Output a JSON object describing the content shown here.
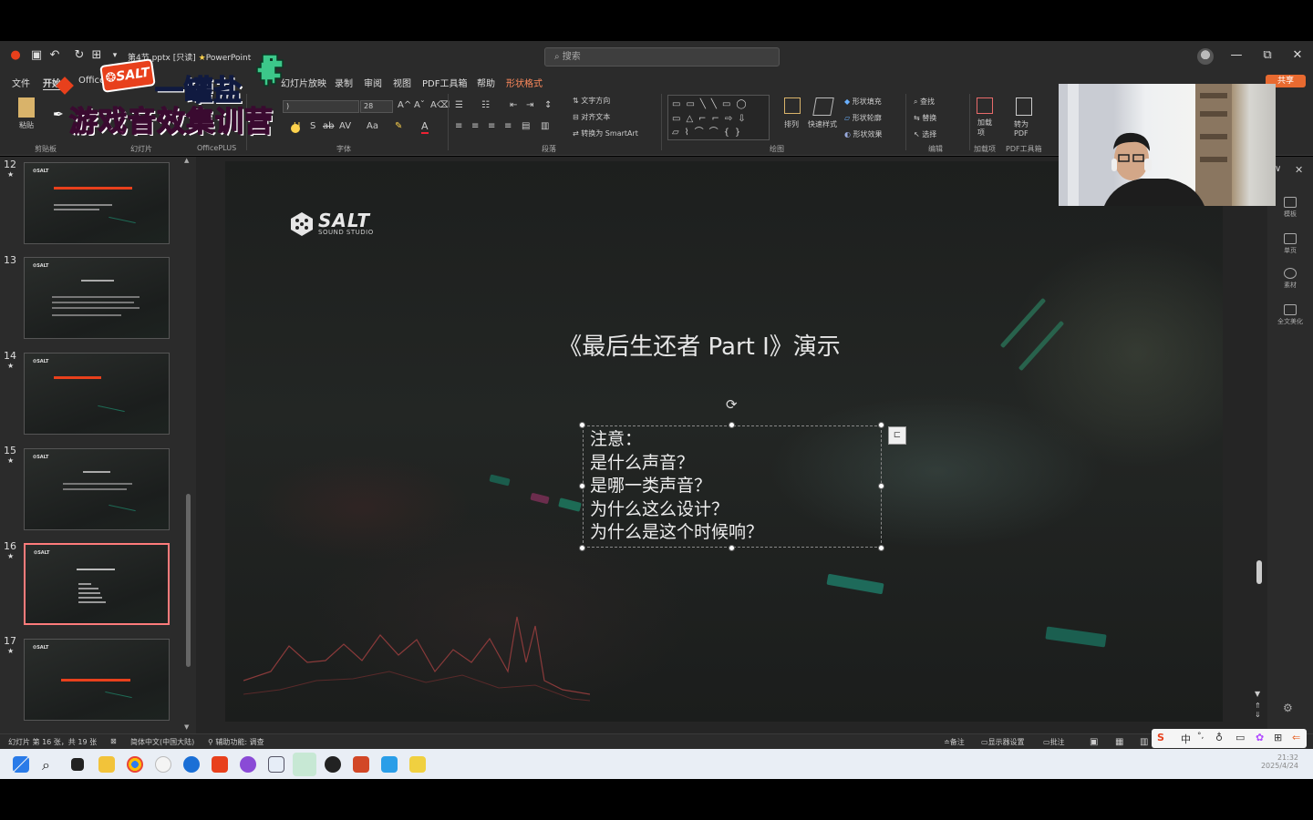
{
  "window": {
    "file_name": "第4节.pptx [只读]",
    "app_name": "PowerPoint",
    "search_placeholder": "搜索",
    "share_label": "共享"
  },
  "ribbon_tabs": [
    "文件",
    "开始",
    "Office",
    "幻灯片放映",
    "录制",
    "审阅",
    "视图",
    "PDF工具箱",
    "帮助",
    "形状格式"
  ],
  "ribbon": {
    "groups": [
      "剪贴板",
      "幻灯片",
      "OfficePLUS",
      "字体",
      "段落",
      "绘图",
      "编辑",
      "加载项",
      "PDF工具箱"
    ],
    "paste_label": "粘贴",
    "font_size": "28",
    "text_direction": "文字方向",
    "align_text": "对齐文本",
    "convert_smartart": "转换为 SmartArt",
    "arrange": "排列",
    "quick_styles": "快速样式",
    "shape_fill": "形状填充",
    "shape_outline": "形状轮廓",
    "shape_effects": "形状效果",
    "find": "查找",
    "replace": "替换",
    "select": "选择",
    "addins": "加载项",
    "to_pdf": "转为PDF"
  },
  "promo": {
    "line1": "一罐盐",
    "line2": "游戏音效集训营",
    "badge": "SALT"
  },
  "thumbnails": [
    {
      "num": "12",
      "star": "★",
      "selected": false
    },
    {
      "num": "13",
      "star": "",
      "selected": false
    },
    {
      "num": "14",
      "star": "★",
      "selected": false
    },
    {
      "num": "15",
      "star": "★",
      "selected": false
    },
    {
      "num": "16",
      "star": "★",
      "selected": true
    },
    {
      "num": "17",
      "star": "★",
      "selected": false
    }
  ],
  "slide": {
    "logo_main": "SALT",
    "logo_sub": "SOUND STUDIO",
    "title": "《最后生还者 Part I》演示",
    "body_lines": [
      "注意：",
      "是什么声音？",
      "是哪一类声音？",
      "为什么这么设计？",
      "为什么是这个时候响？"
    ]
  },
  "right_panel": [
    "模板",
    "单页",
    "素材",
    "全文美化"
  ],
  "status": {
    "slide_info": "幻灯片 第 16 张，共 19 张",
    "language": "简体中文(中国大陆)",
    "accessibility": "辅助功能: 调查",
    "notes": "备注",
    "display_settings": "显示器设置",
    "comments": "批注"
  },
  "ime": {
    "lang": "中"
  },
  "clock": {
    "time": "21:32",
    "date": "2025/4/24"
  },
  "colors": {
    "accent_tab": "#ff8a5c",
    "selection_border": "#ff7b7b",
    "promo_blue": "#3c8cff",
    "promo_pink": "#ff55c8"
  }
}
